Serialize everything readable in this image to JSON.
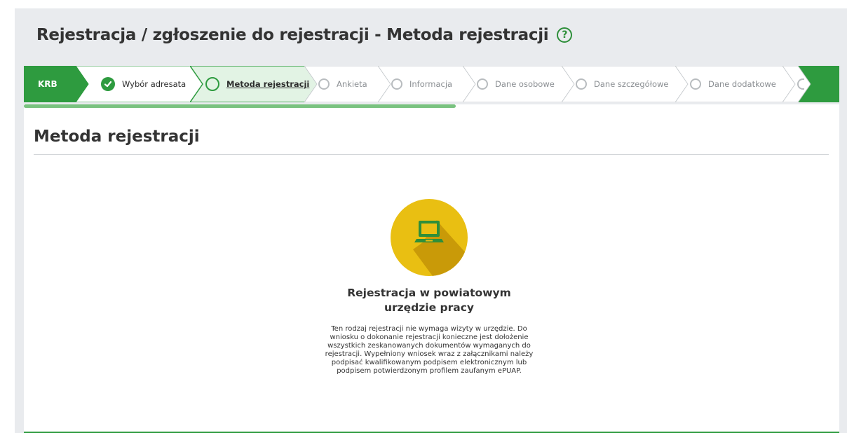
{
  "header": {
    "title": "Rejestracja / zgłoszenie do rejestracji - Metoda rejestracji",
    "help_icon": "?"
  },
  "stepper": {
    "root_label": "KRB",
    "steps": [
      {
        "label": "Wybór adresata",
        "state": "done"
      },
      {
        "label": "Metoda rejestracji",
        "state": "active"
      },
      {
        "label": "Ankieta",
        "state": "pending"
      },
      {
        "label": "Informacja",
        "state": "pending"
      },
      {
        "label": "Dane osobowe",
        "state": "pending"
      },
      {
        "label": "Dane szczegółowe",
        "state": "pending"
      },
      {
        "label": "Dane dodatkowe",
        "state": "pending"
      }
    ],
    "progress_fraction": 0.53
  },
  "main": {
    "section_title": "Metoda rejestracji",
    "option": {
      "icon": "laptop-icon",
      "title": "Rejestracja w powiatowym urzędzie pracy",
      "description": "Ten rodzaj rejestracji nie wymaga wizyty w urzędzie. Do wniosku o dokonanie rejestracji konieczne jest dołożenie wszystkich zeskanowanych dokumentów wymaganych do rejestracji. Wypełniony wniosek wraz z załącznikami należy podpisać kwalifikowanym podpisem elektronicznym lub podpisem potwierdzonym profilem zaufanym ePUAP."
    }
  },
  "colors": {
    "accent_green": "#2e9b3f",
    "active_step_bg": "#e2f3e4",
    "icon_yellow": "#e9bf12"
  }
}
